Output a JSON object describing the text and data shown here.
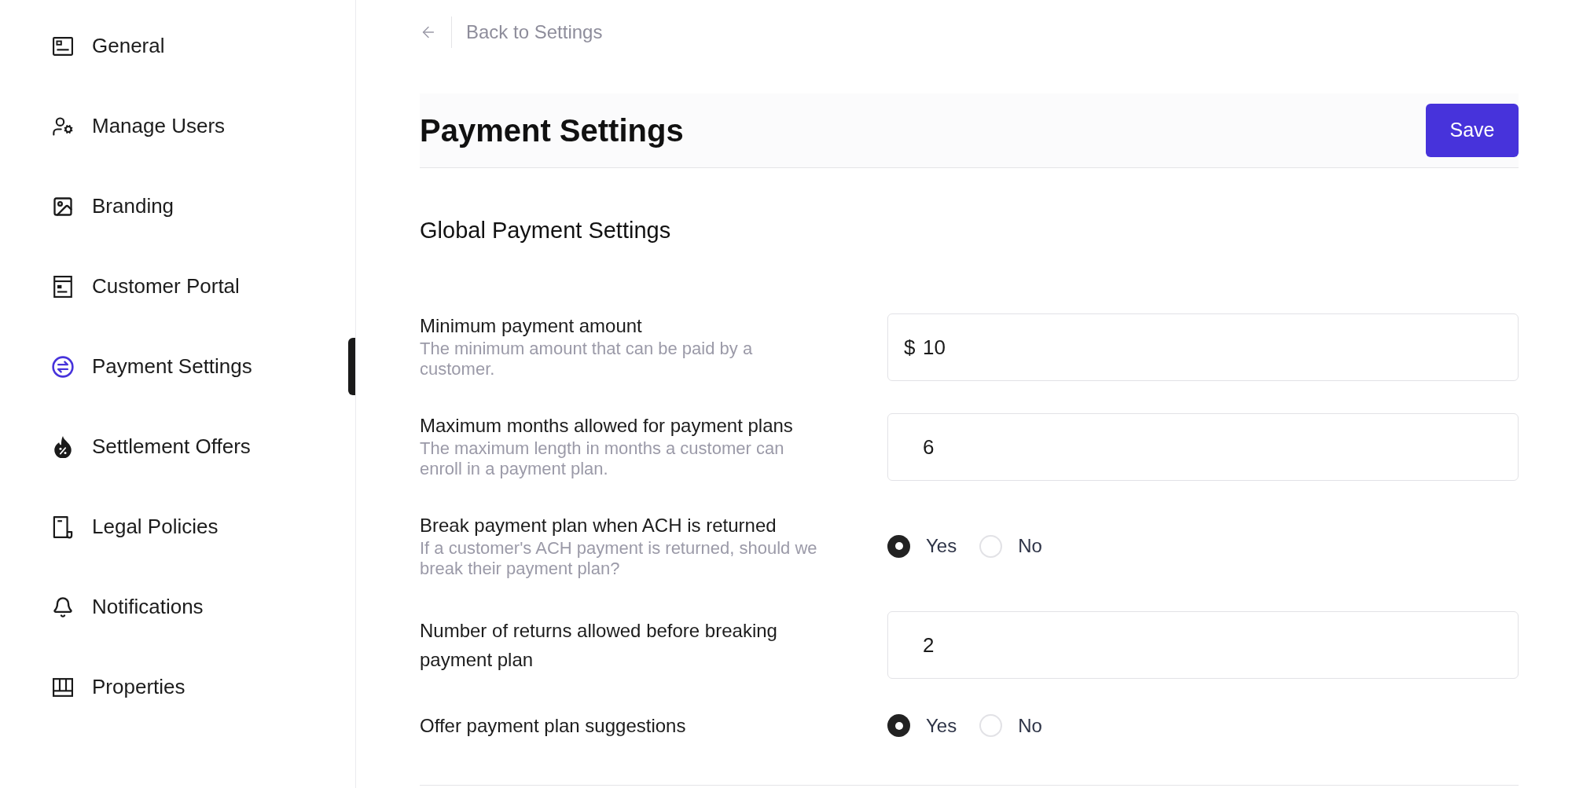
{
  "sidebar": {
    "items": [
      {
        "label": "General",
        "selected": false
      },
      {
        "label": "Manage Users",
        "selected": false
      },
      {
        "label": "Branding",
        "selected": false
      },
      {
        "label": "Customer Portal",
        "selected": false
      },
      {
        "label": "Payment Settings",
        "selected": true
      },
      {
        "label": "Settlement Offers",
        "selected": false
      },
      {
        "label": "Legal Policies",
        "selected": false
      },
      {
        "label": "Notifications",
        "selected": false
      },
      {
        "label": "Properties",
        "selected": false
      }
    ]
  },
  "back_link": {
    "label": "Back to Settings"
  },
  "header": {
    "title": "Payment Settings",
    "save_button": {
      "label": "Save"
    }
  },
  "section": {
    "title": "Global Payment Settings"
  },
  "fields": [
    {
      "kind": "input",
      "label": "Minimum payment amount",
      "description": "The minimum amount that can be paid by a customer.",
      "prefix": "$",
      "value": "10"
    },
    {
      "kind": "input",
      "label": "Maximum months allowed for payment plans",
      "description": "The maximum length in months a customer can enroll in a payment plan.",
      "value": "6"
    },
    {
      "kind": "radio",
      "label": "Break payment plan when ACH is returned",
      "description": "If a customer's ACH payment is returned, should we break their payment plan?",
      "options": [
        {
          "label": "Yes",
          "selected": true
        },
        {
          "label": "No",
          "selected": false
        }
      ]
    },
    {
      "kind": "input",
      "label": "Number of returns allowed before breaking payment plan",
      "value": "2"
    },
    {
      "kind": "radio",
      "label": "Offer payment plan suggestions",
      "options": [
        {
          "label": "Yes",
          "selected": true
        },
        {
          "label": "No",
          "selected": false
        }
      ]
    }
  ]
}
